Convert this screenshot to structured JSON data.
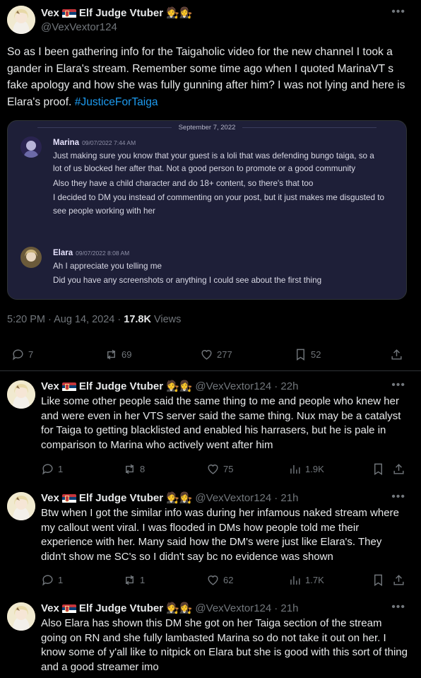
{
  "main_tweet": {
    "display_name": "Vex",
    "name_suffix": "Elf Judge Vtuber",
    "emojis": "🧑‍⚖️👩‍⚖️",
    "handle": "@VexVextor124",
    "text_plain": "So as I been gathering info for the Taigaholic video for the new channel I took a gander in Elara's stream. Remember some time ago when I quoted MarinaVT s fake apology and how she was fully gunning after him? I was not lying and here is Elara's proof. ",
    "hashtag": "#JusticeForTaiga",
    "time": "5:20 PM · Aug 14, 2024 · ",
    "views_count": "17.8K",
    "views_label": " Views",
    "replies": "7",
    "reposts": "69",
    "likes": "277",
    "bookmarks": "52"
  },
  "media": {
    "date_divider": "September 7, 2022",
    "messages": [
      {
        "author": "Marina",
        "timestamp": "09/07/2022 7:44 AM",
        "lines": [
          "Just making sure you know that your guest is a loli that was defending bungo taiga, so a lot of us blocked her after that. Not a good person to promote or a good community",
          "Also they have a child character and do 18+ content, so there's that too",
          "I decided to DM you instead of commenting on your post, but it just makes me disgusted to see people working with her"
        ]
      },
      {
        "author": "Elara",
        "timestamp": "09/07/2022 8:08 AM",
        "lines": [
          "Ah I appreciate you telling me",
          "Did you have any screenshots or anything I could see about the first thing"
        ]
      }
    ]
  },
  "replies": [
    {
      "display_name": "Vex",
      "name_suffix": "Elf Judge Vtuber",
      "emojis": "🧑‍⚖️👩‍⚖️",
      "handle": "@VexVextor124",
      "time": "· 22h",
      "text": "Like some other people said the same thing to me and people who knew her and were even in her VTS server said the same thing. Nux may be a catalyst for Taiga to getting blacklisted and enabled his harrasers, but he is pale in comparison to Marina who actively went after him",
      "replies": "1",
      "reposts": "8",
      "likes": "75",
      "views": "1.9K"
    },
    {
      "display_name": "Vex",
      "name_suffix": "Elf Judge Vtuber",
      "emojis": "🧑‍⚖️👩‍⚖️",
      "handle": "@VexVextor124",
      "time": "· 21h",
      "text": "Btw when I got the similar info was during her infamous naked stream where my callout went viral. I was flooded in DMs how people told me their experience with her. Many said how the DM's were just like Elara's. They didn't show me SC's so I didn't say bc no evidence was shown",
      "replies": "1",
      "reposts": "1",
      "likes": "62",
      "views": "1.7K"
    },
    {
      "display_name": "Vex",
      "name_suffix": "Elf Judge Vtuber",
      "emojis": "🧑‍⚖️👩‍⚖️",
      "handle": "@VexVextor124",
      "time": "· 21h",
      "text": "Also Elara has shown this DM she got on her Taiga section of the stream going on RN and she fully lambasted Marina so do not take it out on her. I know some of y'all like to nitpick on Elara but she is good with this sort of thing and a good streamer imo"
    }
  ],
  "icons": {
    "reply": "reply-icon",
    "repost": "repost-icon",
    "like": "heart-icon",
    "views": "views-icon",
    "bookmark": "bookmark-icon",
    "share": "share-icon",
    "more": "more-icon"
  },
  "colors": {
    "background": "#000000",
    "text": "#e7e9ea",
    "muted": "#71767b",
    "accent": "#1d9bf0",
    "divider": "#2f3336"
  }
}
